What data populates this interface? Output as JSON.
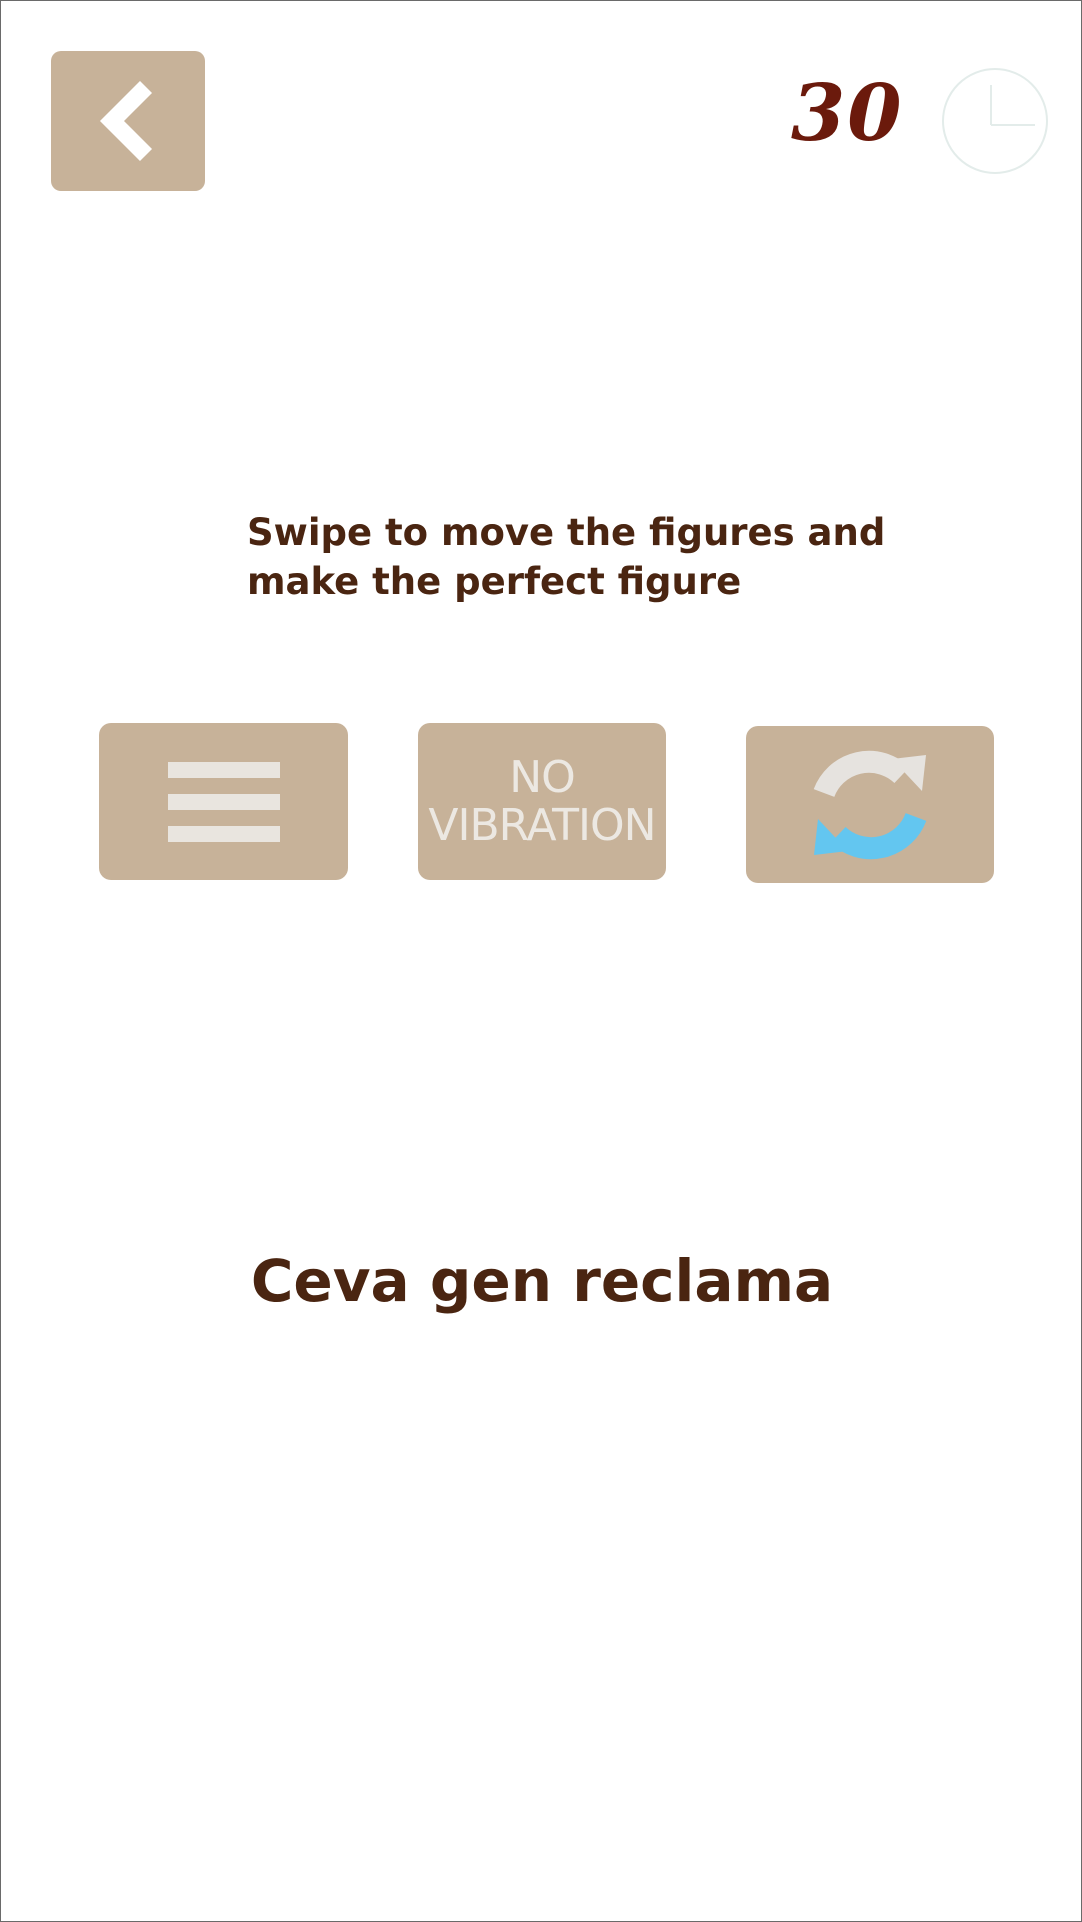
{
  "header": {
    "back_icon": "chevron-left-icon",
    "timer_value": "30",
    "clock_icon": "clock-icon"
  },
  "instructions": {
    "line1": "Swipe to move the figures and",
    "line2": "make the perfect figure"
  },
  "buttons": {
    "menu_icon": "hamburger-menu-icon",
    "vibration_line1": "NO",
    "vibration_line2": "VIBRATION",
    "restart_icon": "refresh-icon"
  },
  "ad": {
    "text": "Ceva gen reclama"
  },
  "colors": {
    "button_bg": "#c7b299",
    "text_dark": "#4a2511",
    "timer_red": "#6b1a0c",
    "refresh_blue": "#63c6f0",
    "refresh_light": "#e6e3df"
  }
}
